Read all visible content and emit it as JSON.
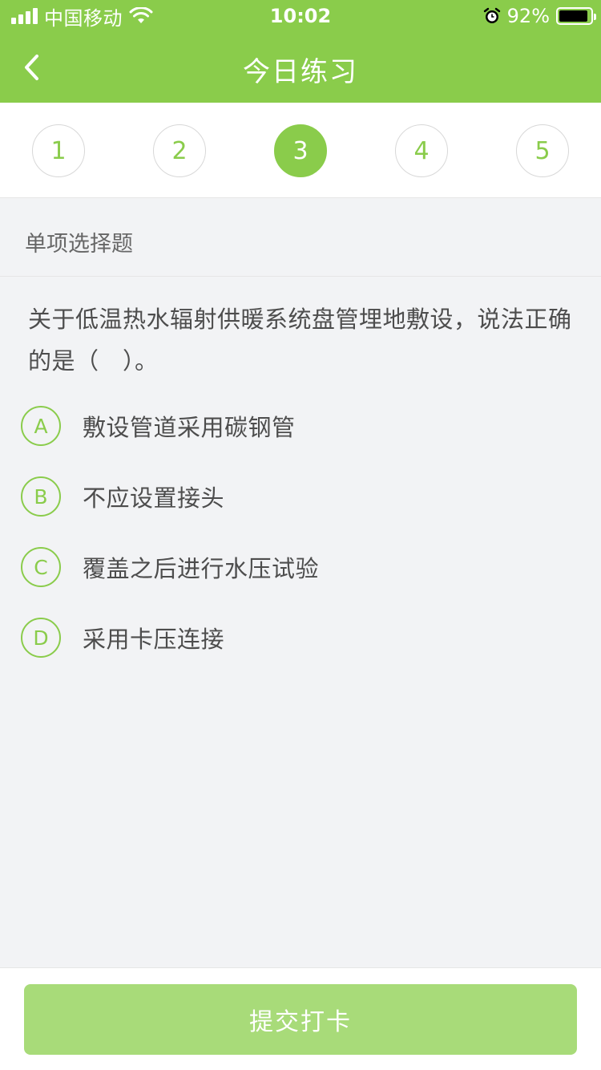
{
  "status_bar": {
    "carrier": "中国移动",
    "time": "10:02",
    "battery_percent": "92%",
    "battery_level": 0.92,
    "icons": [
      "signal-icon",
      "wifi-icon",
      "alarm-icon",
      "battery-icon"
    ]
  },
  "nav": {
    "back_icon": "chevron-left-icon",
    "title": "今日练习"
  },
  "steps": {
    "items": [
      "1",
      "2",
      "3",
      "4",
      "5"
    ],
    "active_index": 2
  },
  "question_type": "单项选择题",
  "question": {
    "text": "关于低温热水辐射供暖系统盘管埋地敷设，说法正确的是（　）。"
  },
  "options": [
    {
      "letter": "A",
      "text": "敷设管道采用碳钢管"
    },
    {
      "letter": "B",
      "text": "不应设置接头"
    },
    {
      "letter": "C",
      "text": "覆盖之后进行水压试验"
    },
    {
      "letter": "D",
      "text": "采用卡压连接"
    }
  ],
  "submit_label": "提交打卡",
  "colors": {
    "brand_green": "#8acc4b",
    "button_green": "#a8db79",
    "background": "#f2f3f5"
  }
}
